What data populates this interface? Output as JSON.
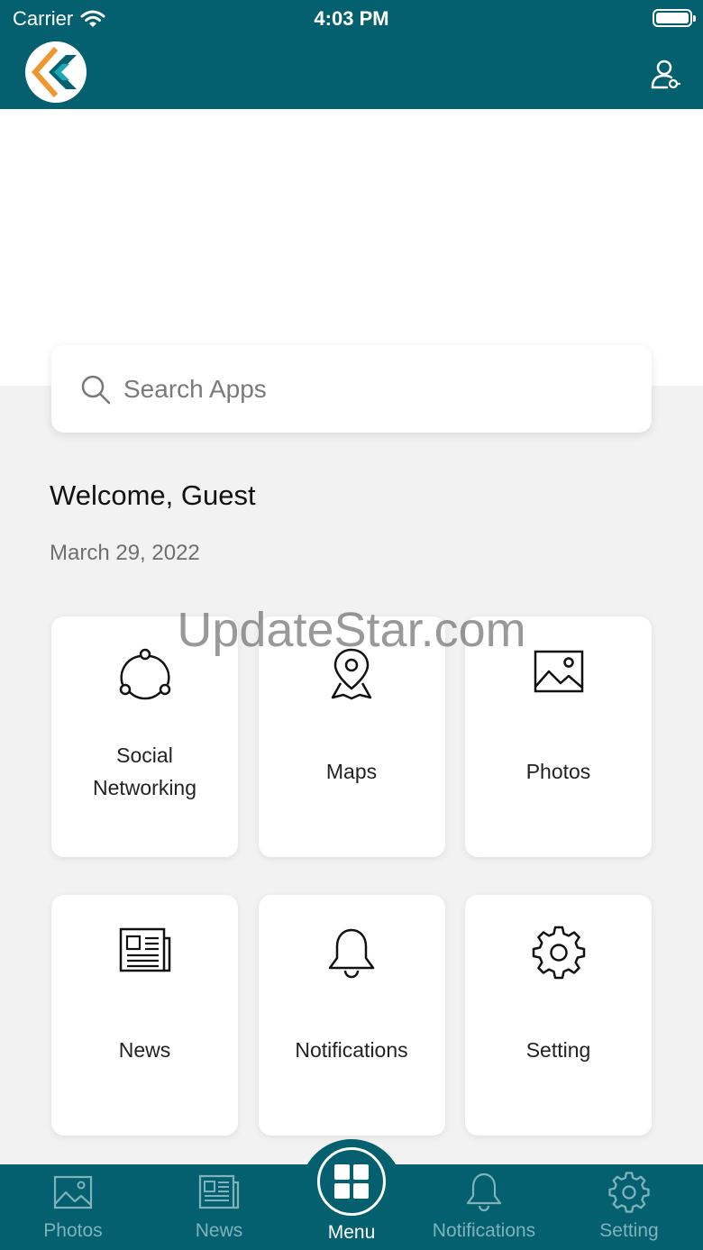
{
  "status_bar": {
    "carrier": "Carrier",
    "time": "4:03 PM"
  },
  "search": {
    "placeholder": "Search Apps"
  },
  "welcome_text": "Welcome, Guest",
  "date_text": "March 29, 2022",
  "watermark": "UpdateStar.com",
  "tiles": [
    {
      "label": "Social Networking",
      "icon": "social-network-icon"
    },
    {
      "label": "Maps",
      "icon": "map-pin-icon"
    },
    {
      "label": "Photos",
      "icon": "photo-icon"
    },
    {
      "label": "News",
      "icon": "newspaper-icon"
    },
    {
      "label": "Notifications",
      "icon": "bell-icon"
    },
    {
      "label": "Setting",
      "icon": "gear-icon"
    }
  ],
  "tab_bar": {
    "photos": "Photos",
    "news": "News",
    "menu": "Menu",
    "notifications": "Notifications",
    "setting": "Setting"
  },
  "colors": {
    "brand": "#04606f",
    "accent_orange": "#f0962e",
    "inactive_tab": "#7fb2bb"
  }
}
